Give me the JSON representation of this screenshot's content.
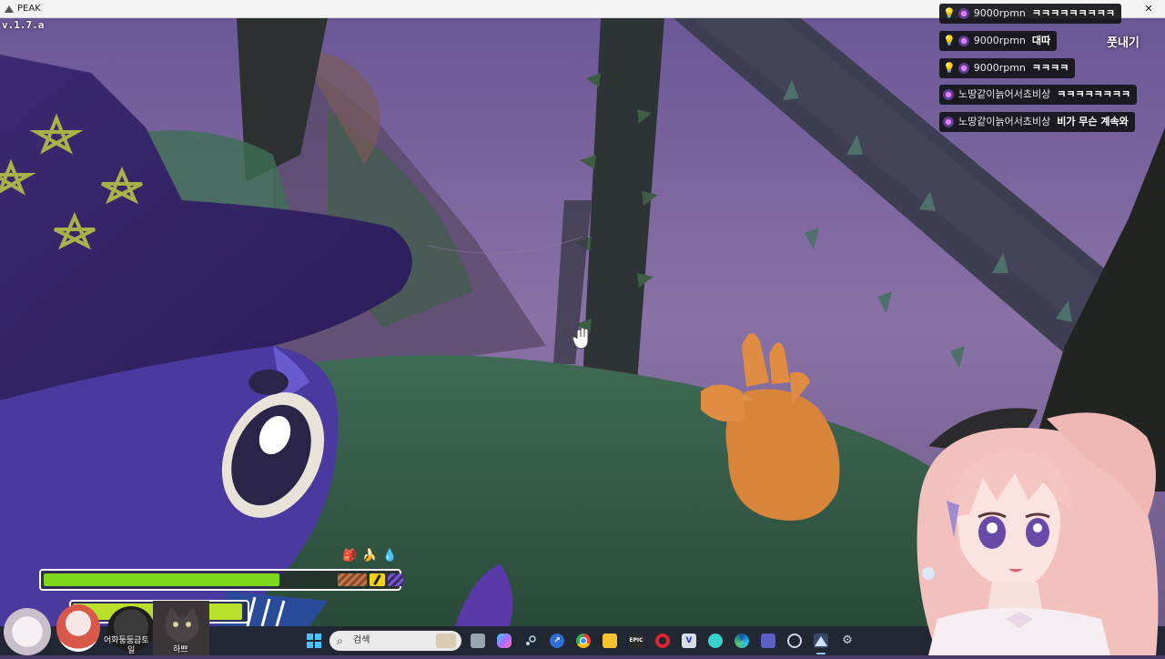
{
  "window": {
    "title": "PEAK",
    "controls": [
      "—",
      "☐",
      "✕"
    ]
  },
  "hud": {
    "version": "v.1.7.a",
    "stamina_fraction": 0.81,
    "friend_stamina_fraction": 0.97
  },
  "chat": {
    "messages": [
      {
        "user": "9000rpmn",
        "text": "ㅋㅋㅋㅋㅋㅋㅋㅋㅋ",
        "badges": [
          "bulb-icon",
          "star-badge-icon"
        ]
      },
      {
        "user": "9000rpmn",
        "text": "대따",
        "badges": [
          "bulb-icon",
          "star-badge-icon"
        ]
      },
      {
        "user": "9000rpmn",
        "text": "ㅋㅋㅋㅋ",
        "badges": [
          "bulb-icon",
          "star-badge-icon"
        ]
      },
      {
        "user": "노땅같이늙어서쵸비상",
        "text": "ㅋㅋㅋㅋㅋㅋㅋㅋ",
        "badges": [
          "star-badge-icon"
        ]
      },
      {
        "user": "노땅같이늙어서쵸비상",
        "text": "비가 무슨 계속와",
        "badges": [
          "star-badge-icon"
        ]
      }
    ],
    "side_label": "풋내기"
  },
  "overlay": {
    "avatar_label_1": "어화둥둥금토",
    "avatar_label_2": "일",
    "cat_label": "하쁘"
  },
  "taskbar": {
    "search_placeholder": "검색",
    "epic_label": "EPIC",
    "icons": [
      "windows-start-icon",
      "search-icon",
      "task-view-icon",
      "copilot-icon",
      "steam-icon",
      "pin-icon",
      "chrome-icon",
      "folder-icon",
      "epic-games-icon",
      "opera-icon",
      "v-app-icon",
      "bird-app-icon",
      "edge-icon",
      "teams-icon",
      "clock-app-icon",
      "peak-game-icon",
      "settings-icon"
    ]
  },
  "colors": {
    "stamina": "#7fd71b",
    "friend_stamina": "#b8e02a",
    "taskbar": "#202632"
  }
}
